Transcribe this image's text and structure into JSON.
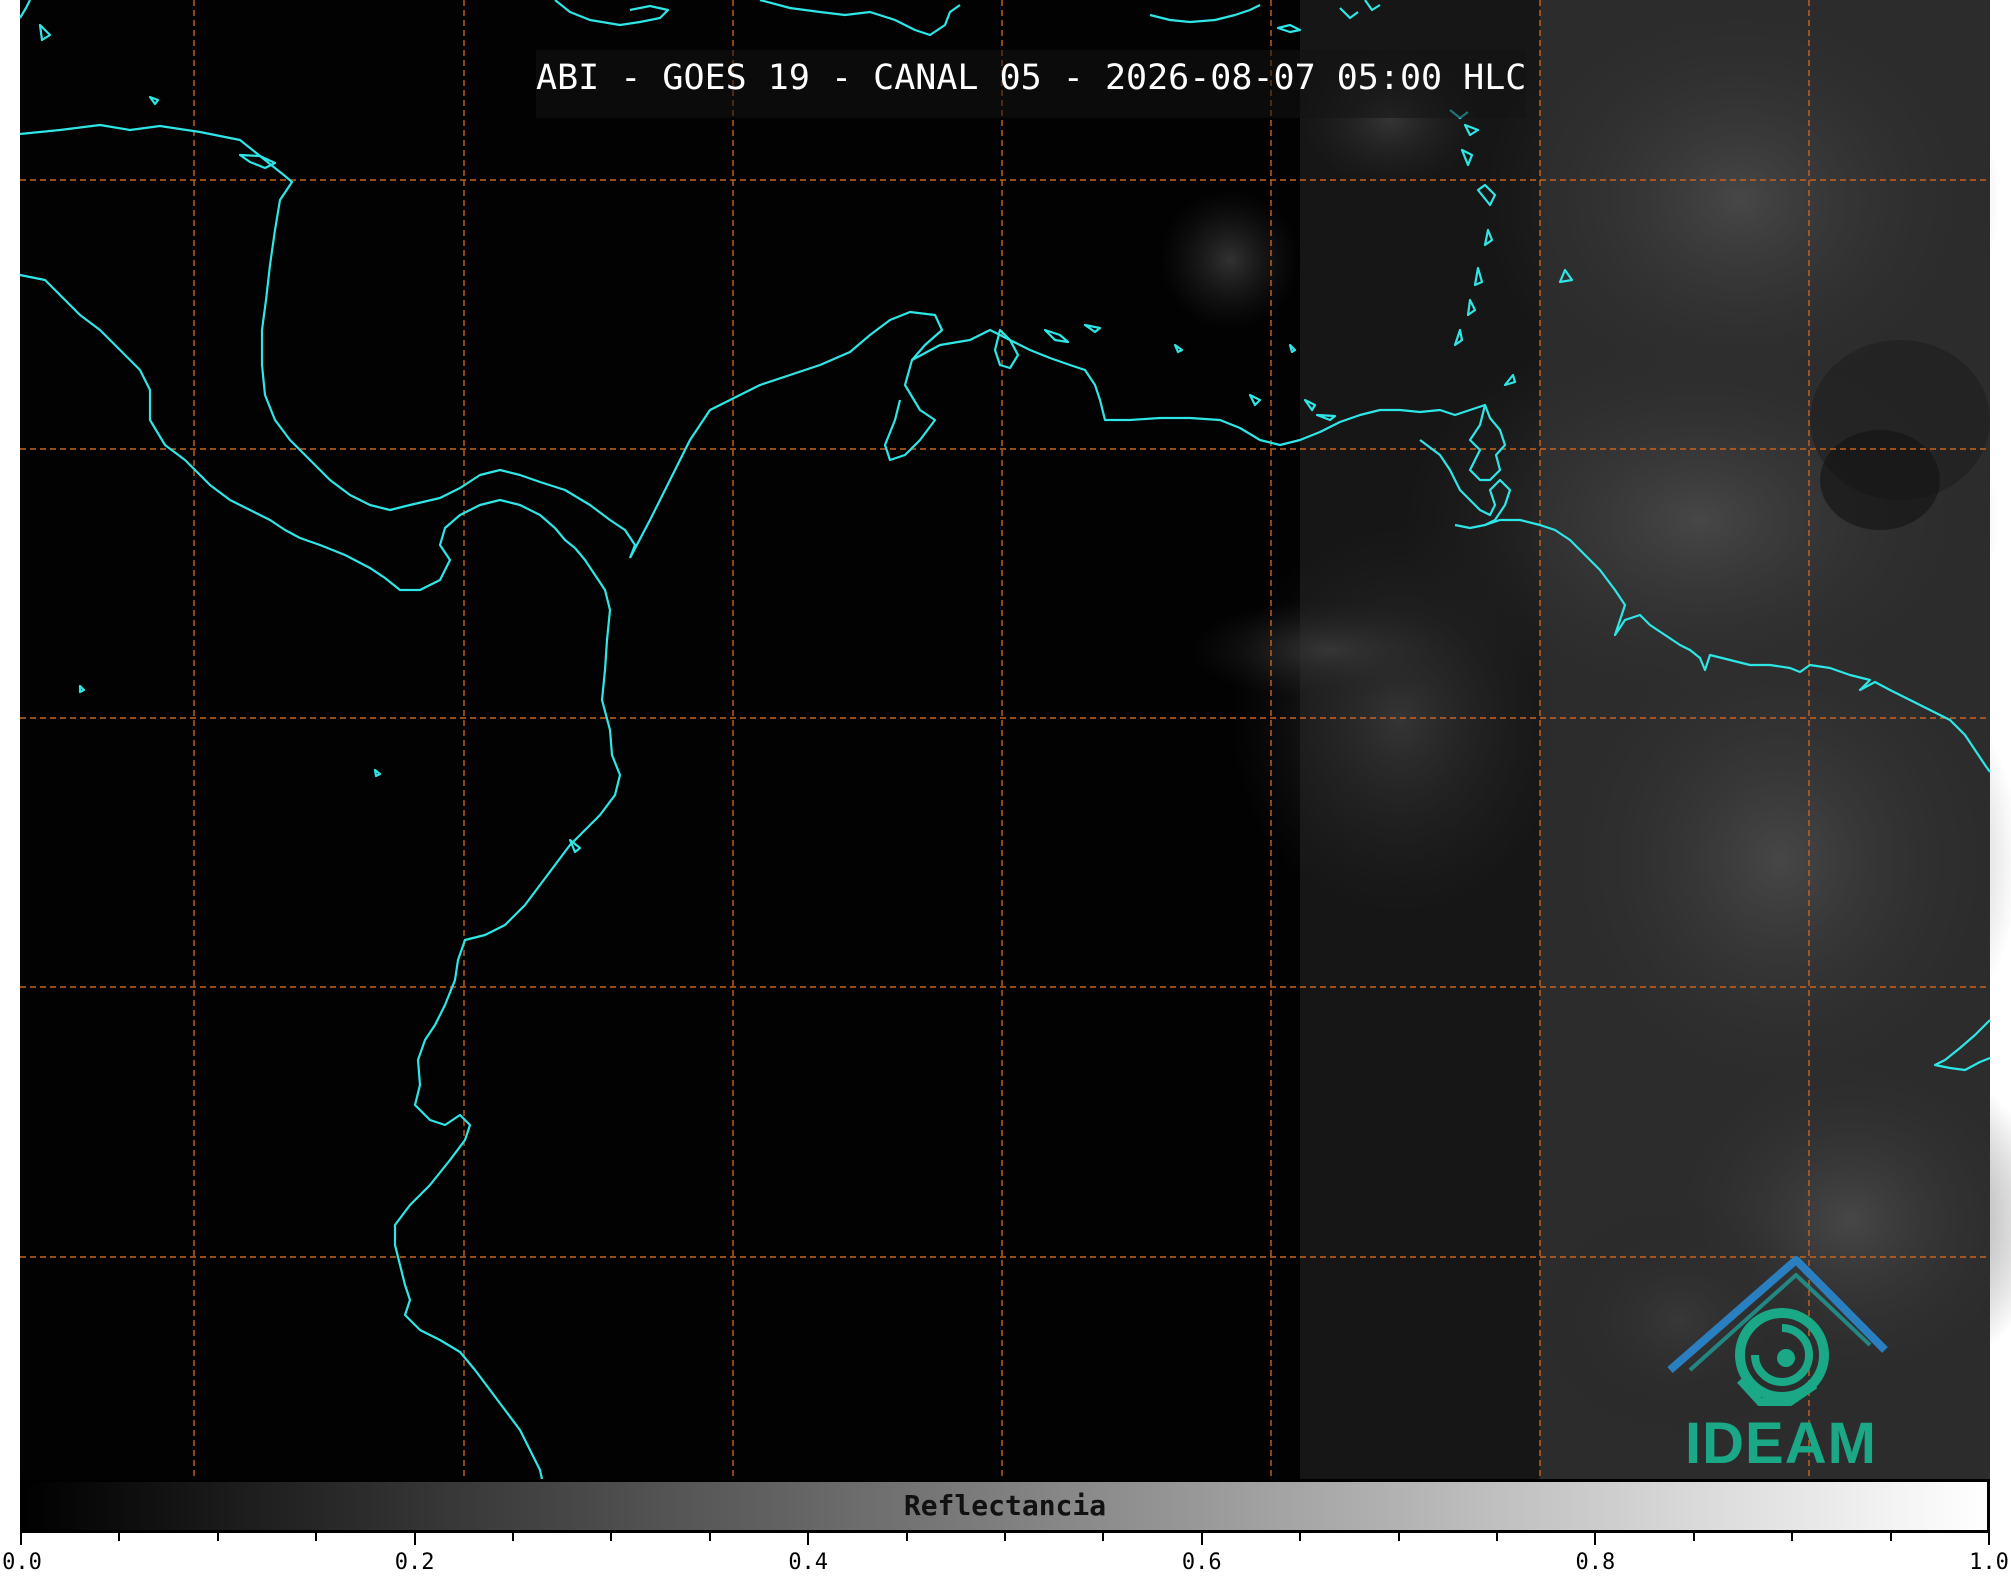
{
  "title": "ABI - GOES 19 - CANAL 05 - 2026-08-07 05:00 HLC",
  "logo": {
    "text": "IDEAM",
    "colors": {
      "top": "#2a7fc1",
      "bottom": "#1aa886"
    }
  },
  "colorbar": {
    "label": "Reflectancia",
    "colormap": [
      "#000000",
      "#ffffff"
    ],
    "min": 0.0,
    "max": 1.0,
    "ticks": [
      "0.0",
      "0.2",
      "0.4",
      "0.6",
      "0.8",
      "1.0"
    ]
  },
  "map": {
    "background": "#020202",
    "coastline_color": "#2fe6e6",
    "grid_color": "#c8641e",
    "grid_style": "dashed"
  }
}
